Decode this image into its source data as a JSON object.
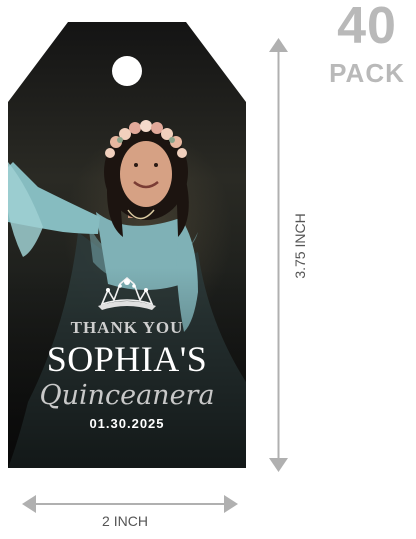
{
  "pack": {
    "count": "40",
    "label": "PACK"
  },
  "tag": {
    "thank_you": "THANK YOU",
    "name": "SOPHIA'S",
    "event_script": "Quinceanera",
    "date": "01.30.2025"
  },
  "dimensions": {
    "height_label": "3.75 INCH",
    "width_label": "2 INCH"
  },
  "colors": {
    "tag_background": "#141414",
    "arrow": "#b0b0b0",
    "pack_text": "#b9b9b9"
  }
}
